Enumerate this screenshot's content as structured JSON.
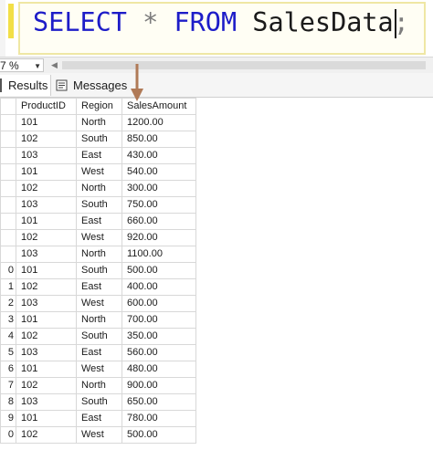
{
  "editor": {
    "keyword_select": "SELECT",
    "star": "*",
    "keyword_from": "FROM",
    "table_name": "SalesData",
    "terminator": ";"
  },
  "zoom": {
    "value": "7 %"
  },
  "tabs": [
    {
      "label": "Results",
      "icon": "grid-icon"
    },
    {
      "label": "Messages",
      "icon": "messages-icon"
    }
  ],
  "colors": {
    "keyword": "#1d1cc8",
    "selection_border": "#efe7a4",
    "annotation_arrow": "#b07a57"
  },
  "grid": {
    "columns": [
      "ProductID",
      "Region",
      "SalesAmount"
    ],
    "rows": [
      {
        "rownum": "",
        "ProductID": "101",
        "Region": "North",
        "SalesAmount": "1200.00"
      },
      {
        "rownum": "",
        "ProductID": "102",
        "Region": "South",
        "SalesAmount": "850.00"
      },
      {
        "rownum": "",
        "ProductID": "103",
        "Region": "East",
        "SalesAmount": "430.00"
      },
      {
        "rownum": "",
        "ProductID": "101",
        "Region": "West",
        "SalesAmount": "540.00"
      },
      {
        "rownum": "",
        "ProductID": "102",
        "Region": "North",
        "SalesAmount": "300.00"
      },
      {
        "rownum": "",
        "ProductID": "103",
        "Region": "South",
        "SalesAmount": "750.00"
      },
      {
        "rownum": "",
        "ProductID": "101",
        "Region": "East",
        "SalesAmount": "660.00"
      },
      {
        "rownum": "",
        "ProductID": "102",
        "Region": "West",
        "SalesAmount": "920.00"
      },
      {
        "rownum": "",
        "ProductID": "103",
        "Region": "North",
        "SalesAmount": "1100.00"
      },
      {
        "rownum": "0",
        "ProductID": "101",
        "Region": "South",
        "SalesAmount": "500.00"
      },
      {
        "rownum": "1",
        "ProductID": "102",
        "Region": "East",
        "SalesAmount": "400.00"
      },
      {
        "rownum": "2",
        "ProductID": "103",
        "Region": "West",
        "SalesAmount": "600.00"
      },
      {
        "rownum": "3",
        "ProductID": "101",
        "Region": "North",
        "SalesAmount": "700.00"
      },
      {
        "rownum": "4",
        "ProductID": "102",
        "Region": "South",
        "SalesAmount": "350.00"
      },
      {
        "rownum": "5",
        "ProductID": "103",
        "Region": "East",
        "SalesAmount": "560.00"
      },
      {
        "rownum": "6",
        "ProductID": "101",
        "Region": "West",
        "SalesAmount": "480.00"
      },
      {
        "rownum": "7",
        "ProductID": "102",
        "Region": "North",
        "SalesAmount": "900.00"
      },
      {
        "rownum": "8",
        "ProductID": "103",
        "Region": "South",
        "SalesAmount": "650.00"
      },
      {
        "rownum": "9",
        "ProductID": "101",
        "Region": "East",
        "SalesAmount": "780.00"
      },
      {
        "rownum": "0",
        "ProductID": "102",
        "Region": "West",
        "SalesAmount": "500.00"
      }
    ]
  }
}
